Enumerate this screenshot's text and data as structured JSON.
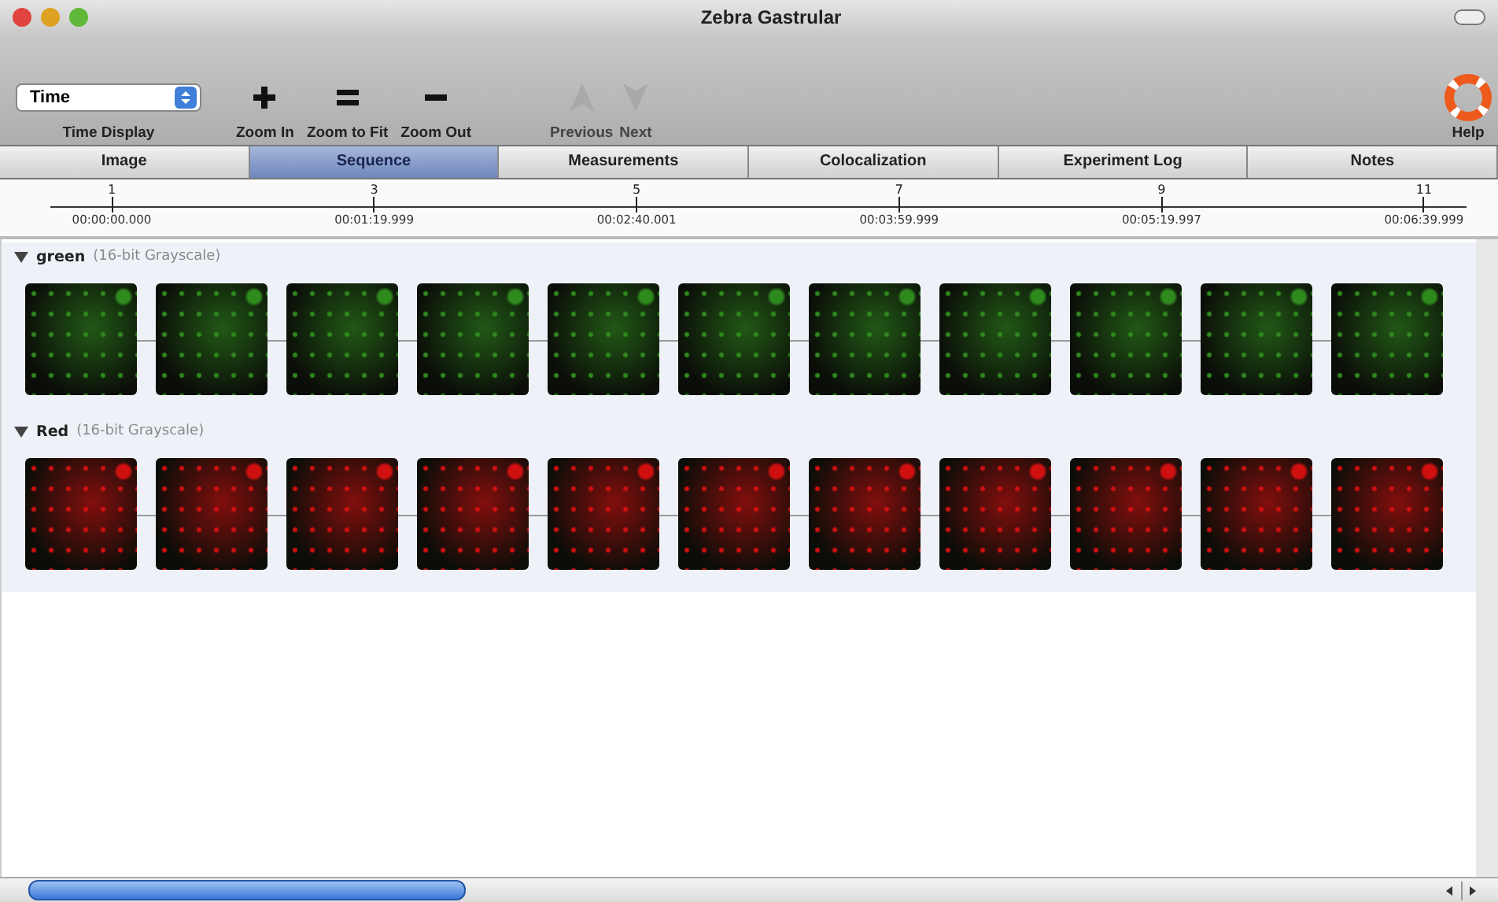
{
  "window": {
    "title": "Zebra Gastrular"
  },
  "toolbar": [
    {
      "kind": "dropdown",
      "value": "Time",
      "label": "Time Display",
      "disabled": false
    },
    {
      "kind": "plus",
      "label": "Zoom In",
      "disabled": false
    },
    {
      "kind": "equals",
      "label": "Zoom to Fit",
      "disabled": false
    },
    {
      "kind": "minus",
      "label": "Zoom Out",
      "disabled": false
    },
    {
      "kind": "up",
      "label": "Previous",
      "disabled": true
    },
    {
      "kind": "down",
      "label": "Next",
      "disabled": true
    },
    {
      "kind": "help",
      "label": "Help",
      "disabled": false
    }
  ],
  "tabs": [
    {
      "label": "Image",
      "selected": false
    },
    {
      "label": "Sequence",
      "selected": true
    },
    {
      "label": "Measurements",
      "selected": false
    },
    {
      "label": "Colocalization",
      "selected": false
    },
    {
      "label": "Experiment Log",
      "selected": false
    },
    {
      "label": "Notes",
      "selected": false
    }
  ],
  "timeline": [
    {
      "frame": "1",
      "time": "00:00:00.000"
    },
    {
      "frame": "3",
      "time": "00:01:19.999"
    },
    {
      "frame": "5",
      "time": "00:02:40.001"
    },
    {
      "frame": "7",
      "time": "00:03:59.999"
    },
    {
      "frame": "9",
      "time": "00:05:19.997"
    },
    {
      "frame": "11",
      "time": "00:06:39.999"
    }
  ],
  "channels": [
    {
      "name": "green",
      "format": "(16-bit Grayscale)",
      "expanded": true,
      "color": "#2f8a1e"
    },
    {
      "name": "Red",
      "format": "(16-bit Grayscale)",
      "expanded": true,
      "color": "#d01010"
    }
  ]
}
